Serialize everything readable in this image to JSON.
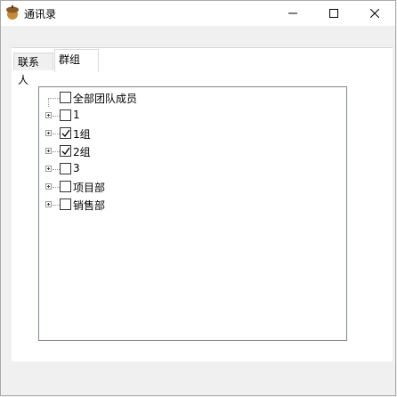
{
  "window": {
    "title": "通讯录",
    "icon": "acorn-app-icon",
    "controls": [
      "minimize-icon",
      "maximize-icon",
      "close-icon"
    ]
  },
  "tabs": [
    {
      "label": "联系人",
      "selected": false
    },
    {
      "label": "群组",
      "selected": true
    }
  ],
  "tree": {
    "root": {
      "label": "全部团队成员",
      "checked": false
    },
    "items": [
      {
        "label": "1",
        "checked": false
      },
      {
        "label": "1组",
        "checked": true
      },
      {
        "label": "2组",
        "checked": true
      },
      {
        "label": "3",
        "checked": false
      },
      {
        "label": "项目部",
        "checked": false
      },
      {
        "label": "销售部",
        "checked": false
      }
    ]
  }
}
